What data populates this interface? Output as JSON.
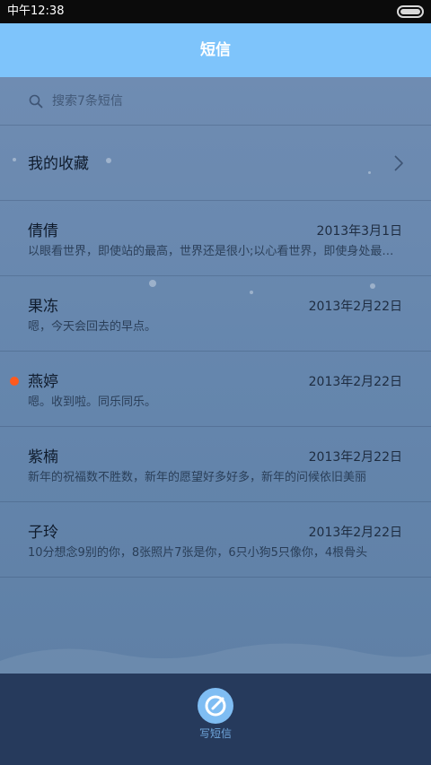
{
  "status_bar": {
    "time": "中午12:38"
  },
  "header": {
    "title": "短信"
  },
  "search": {
    "placeholder": "搜索7条短信"
  },
  "favorites": {
    "label": "我的收藏"
  },
  "messages": [
    {
      "name": "倩倩",
      "date": "2013年3月1日",
      "preview": "以眼看世界，即使站的最高，世界还是很小;以心看世界，即使身处最低，世界依然很大",
      "unread": false
    },
    {
      "name": "果冻",
      "date": "2013年2月22日",
      "preview": "嗯，今天会回去的早点。",
      "unread": false
    },
    {
      "name": "燕婷",
      "date": "2013年2月22日",
      "preview": "嗯。收到啦。同乐同乐。",
      "unread": true
    },
    {
      "name": "紫楠",
      "date": "2013年2月22日",
      "preview": "新年的祝福数不胜数，新年的愿望好多好多，新年的问候依旧美丽",
      "unread": false
    },
    {
      "name": "子玲",
      "date": "2013年2月22日",
      "preview": "10分想念9别的你，8张照片7张是你，6只小狗5只像你，4根骨头",
      "unread": false
    }
  ],
  "bottom_bar": {
    "compose_label": "写短信"
  },
  "colors": {
    "header": "#7ec4fb",
    "unread_dot": "#ff5a1e",
    "bottom_bar": "#263a5c",
    "compose": "#7fbdf3"
  }
}
